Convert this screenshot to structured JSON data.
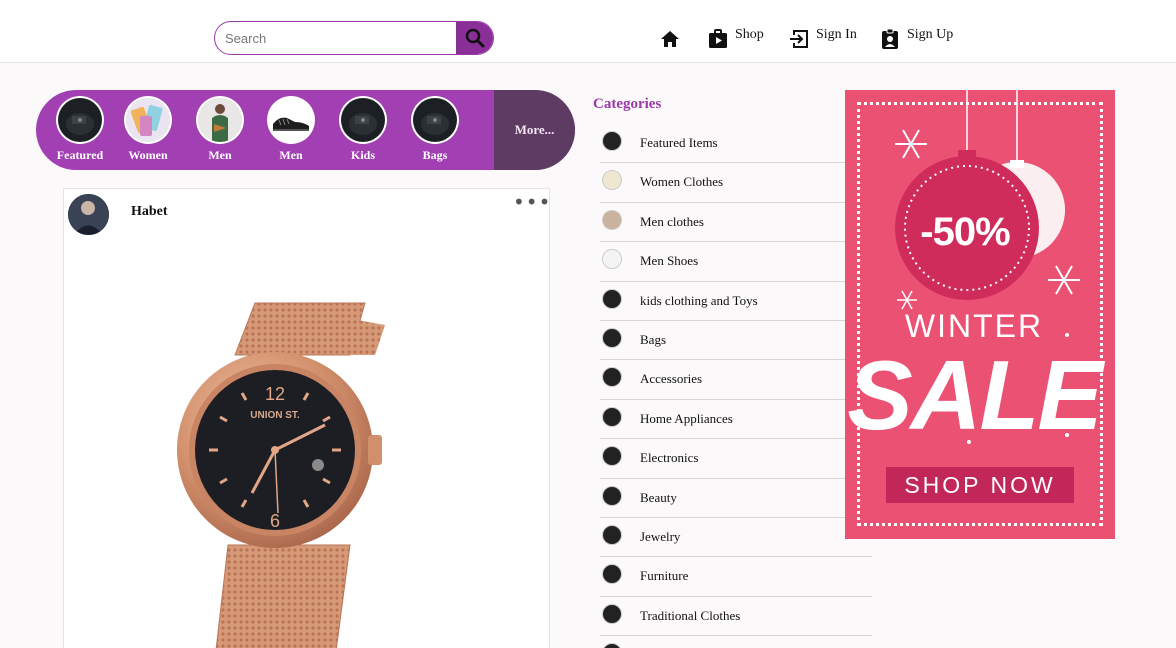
{
  "header": {
    "search": {
      "placeholder": "Search",
      "value": ""
    },
    "nav": {
      "shop": "Shop",
      "sign_in": "Sign In",
      "sign_up": "Sign Up"
    }
  },
  "category_strip": {
    "items": [
      {
        "label": "Featured"
      },
      {
        "label": "Women"
      },
      {
        "label": "Men"
      },
      {
        "label": "Men"
      },
      {
        "label": "Kids"
      },
      {
        "label": "Bags"
      }
    ],
    "more_label": "More..."
  },
  "post": {
    "username": "Habet",
    "menu_glyph": "•••",
    "watch_brand": "UNION ST."
  },
  "categories": {
    "title": "Categories",
    "items": [
      "Featured Items",
      "Women Clothes",
      "Men clothes",
      "Men Shoes",
      "kids clothing and Toys",
      "Bags",
      "Accessories",
      "Home Appliances",
      "Electronics",
      "Beauty",
      "Jewelry",
      "Furniture",
      "Traditional Clothes",
      ""
    ]
  },
  "ad": {
    "discount": "-50%",
    "line1": "WINTER",
    "line2": "SALE",
    "button": "SHOP NOW"
  },
  "colors": {
    "accent": "#a23fb3",
    "accent_dark": "#8a2e98",
    "more_bg": "#5e3b62",
    "ad_bg": "#eb5173",
    "ad_button": "#c2275a"
  }
}
